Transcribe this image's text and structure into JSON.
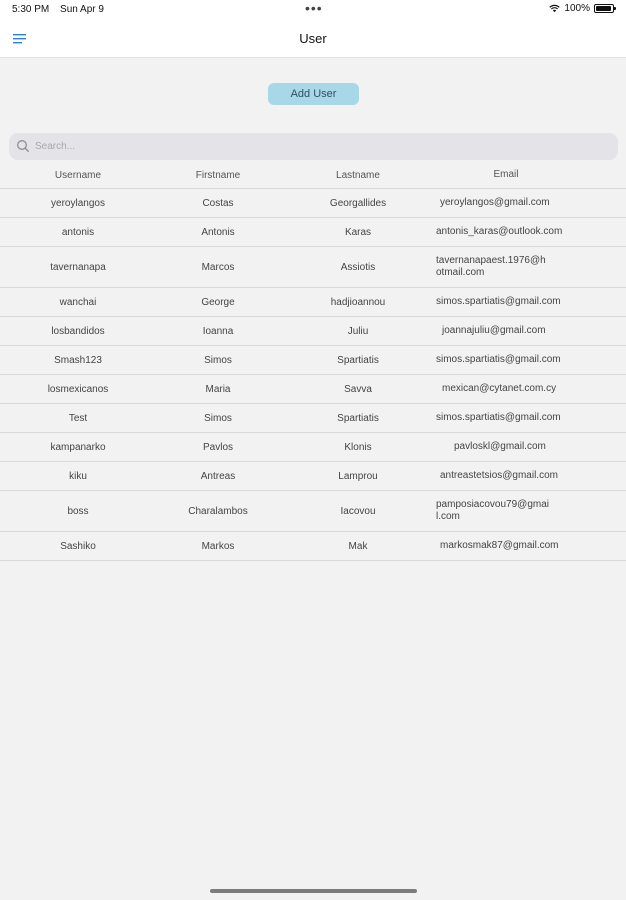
{
  "status_bar": {
    "time": "5:30 PM",
    "date": "Sun Apr 9",
    "battery": "100%"
  },
  "navbar": {
    "title": "User"
  },
  "actions": {
    "add_user_label": "Add User"
  },
  "search": {
    "placeholder": "Search..."
  },
  "table": {
    "headers": [
      "Username",
      "Firstname",
      "Lastname",
      "Email"
    ],
    "rows": [
      [
        "yeroylangos",
        "Costas",
        "Georgallides",
        "yeroylangos@gmail.com"
      ],
      [
        "antonis",
        "Antonis",
        "Karas",
        "antonis_karas@outlook.com"
      ],
      [
        "tavernanapa",
        "Marcos",
        "Assiotis",
        "tavernanapaest.1976@hotmail.com"
      ],
      [
        "wanchai",
        "George",
        "hadjioannou",
        "simos.spartiatis@gmail.com"
      ],
      [
        "losbandidos",
        "Ioanna",
        "Juliu",
        "joannajuliu@gmail.com"
      ],
      [
        "Smash123",
        "Simos",
        "Spartiatis",
        "simos.spartiatis@gmail.com"
      ],
      [
        "losmexicanos",
        "Maria",
        "Savva",
        "mexican@cytanet.com.cy"
      ],
      [
        "Test",
        "Simos",
        "Spartiatis",
        "simos.spartiatis@gmail.com"
      ],
      [
        "kampanarko",
        "Pavlos",
        "Klonis",
        "pavloskl@gmail.com"
      ],
      [
        "kiku",
        "Antreas",
        "Lamprou",
        "antreastetsios@gmail.com"
      ],
      [
        "boss",
        "Charalambos",
        "Iacovou",
        "pamposiacovou79@gmail.com"
      ],
      [
        "Sashiko",
        "Markos",
        "Mak",
        "markosmak87@gmail.com"
      ]
    ]
  }
}
